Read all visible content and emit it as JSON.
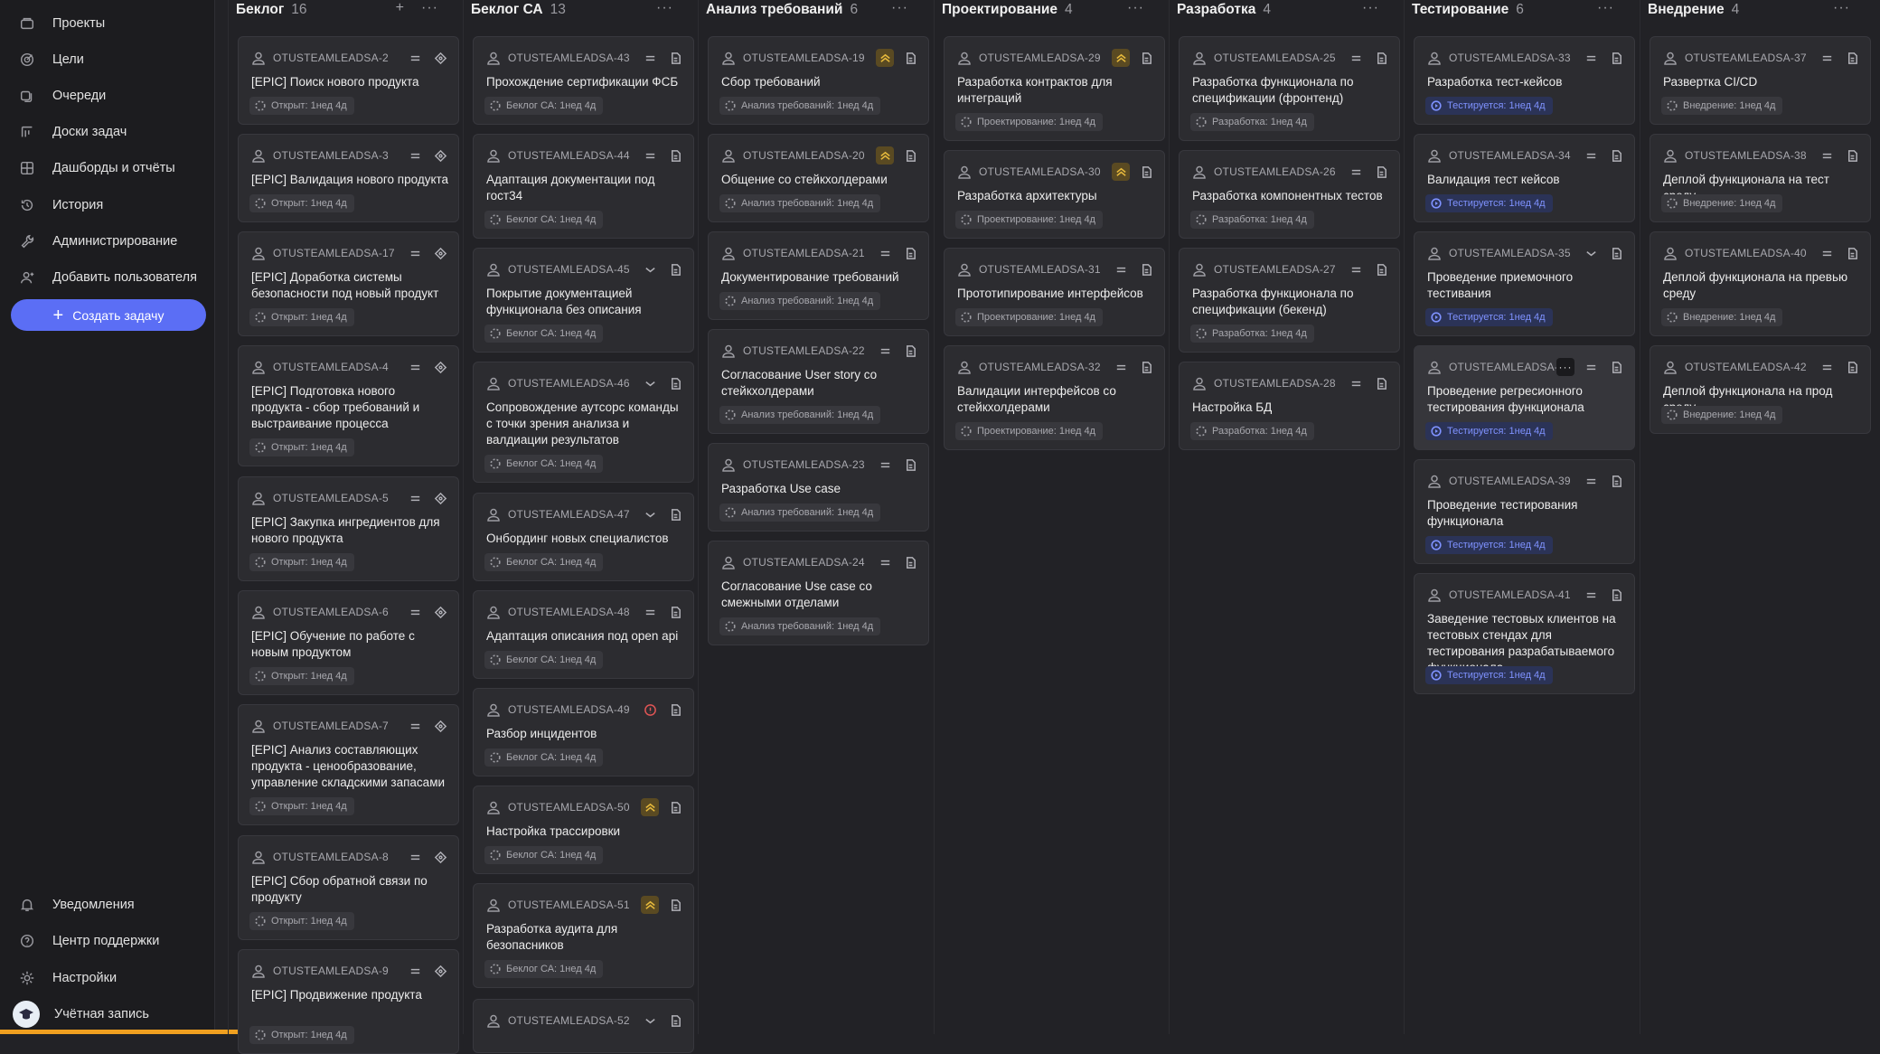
{
  "sidebar": {
    "items": [
      {
        "label": "Проекты",
        "icon": "projects-icon"
      },
      {
        "label": "Цели",
        "icon": "goals-icon"
      },
      {
        "label": "Очереди",
        "icon": "queues-icon"
      },
      {
        "label": "Доски задач",
        "icon": "boards-icon"
      },
      {
        "label": "Дашборды и отчёты",
        "icon": "dashboards-icon"
      },
      {
        "label": "История",
        "icon": "history-icon"
      },
      {
        "label": "Администрирование",
        "icon": "admin-icon"
      },
      {
        "label": "Добавить пользователя",
        "icon": "add-user-icon"
      }
    ],
    "create_label": "Создать задачу",
    "bottom": [
      {
        "label": "Уведомления",
        "icon": "bell-icon"
      },
      {
        "label": "Центр поддержки",
        "icon": "help-icon"
      },
      {
        "label": "Настройки",
        "icon": "gear-icon"
      },
      {
        "label": "Учётная запись",
        "icon": "avatar"
      }
    ]
  },
  "columns": [
    {
      "title": "Беклог",
      "count": "16",
      "add_label": "+",
      "more_label": "···",
      "cards": [
        {
          "key": "OTUSTEAMLEADSA-2",
          "title": "[EPIC] Поиск нового продукта",
          "status": "Открыт: 1нед 4д",
          "type": "epic",
          "prio": "none"
        },
        {
          "key": "OTUSTEAMLEADSA-3",
          "title": "[EPIC] Валидация нового продукта",
          "status": "Открыт: 1нед 4д",
          "type": "epic",
          "prio": "none"
        },
        {
          "key": "OTUSTEAMLEADSA-17",
          "title": "[EPIC] Доработка системы безопасности под новый продукт",
          "status": "Открыт: 1нед 4д",
          "type": "epic",
          "prio": "none"
        },
        {
          "key": "OTUSTEAMLEADSA-4",
          "title": "[EPIC] Подготовка нового продукта - сбор требований и выстраивание процесса",
          "status": "Открыт: 1нед 4д",
          "type": "epic",
          "prio": "none"
        },
        {
          "key": "OTUSTEAMLEADSA-5",
          "title": "[EPIC] Закупка ингредиентов для нового продукта",
          "status": "Открыт: 1нед 4д",
          "type": "epic",
          "prio": "none"
        },
        {
          "key": "OTUSTEAMLEADSA-6",
          "title": "[EPIC] Обучение по работе с новым продуктом",
          "status": "Открыт: 1нед 4д",
          "type": "epic",
          "prio": "none"
        },
        {
          "key": "OTUSTEAMLEADSA-7",
          "title": "[EPIC] Анализ составляющих продукта - ценообразование, управление складскими запасами",
          "status": "Открыт: 1нед 4д",
          "type": "epic",
          "prio": "none"
        },
        {
          "key": "OTUSTEAMLEADSA-8",
          "title": "[EPIC] Сбор обратной связи по продукту",
          "status": "Открыт: 1нед 4д",
          "type": "epic",
          "prio": "none"
        },
        {
          "key": "OTUSTEAMLEADSA-9",
          "title": "[EPIC] Продвижение продукта",
          "status": "Открыт: 1нед 4д",
          "type": "epic",
          "prio": "none"
        }
      ]
    },
    {
      "title": "Беклог СА",
      "count": "13",
      "more_label": "···",
      "cards": [
        {
          "key": "OTUSTEAMLEADSA-43",
          "title": "Прохождение сертификации ФСБ",
          "status": "Беклог СА: 1нед 4д",
          "type": "task",
          "prio": "normal"
        },
        {
          "key": "OTUSTEAMLEADSA-44",
          "title": "Адаптация документации под гост34",
          "status": "Беклог СА: 1нед 4д",
          "type": "task",
          "prio": "normal"
        },
        {
          "key": "OTUSTEAMLEADSA-45",
          "title": "Покрытие документацией функционала без описания",
          "status": "Беклог СА: 1нед 4д",
          "type": "task",
          "prio": "low"
        },
        {
          "key": "OTUSTEAMLEADSA-46",
          "title": "Сопровождение аутсорс команды с точки зрения анализа и валдиации результатов",
          "status": "Беклог СА: 1нед 4д",
          "type": "task",
          "prio": "low"
        },
        {
          "key": "OTUSTEAMLEADSA-47",
          "title": "Онбординг новых специалистов",
          "status": "Беклог СА: 1нед 4д",
          "type": "task",
          "prio": "low"
        },
        {
          "key": "OTUSTEAMLEADSA-48",
          "title": "Адаптация описания под open api",
          "status": "Беклог СА: 1нед 4д",
          "type": "task",
          "prio": "normal"
        },
        {
          "key": "OTUSTEAMLEADSA-49",
          "title": "Разбор инцидентов",
          "status": "Беклог СА: 1нед 4д",
          "type": "task",
          "prio": "critical"
        },
        {
          "key": "OTUSTEAMLEADSA-50",
          "title": "Настройка трассировки",
          "status": "Беклог СА: 1нед 4д",
          "type": "task",
          "prio": "high"
        },
        {
          "key": "OTUSTEAMLEADSA-51",
          "title": "Разработка аудита для безопасников",
          "status": "Беклог СА: 1нед 4д",
          "type": "task",
          "prio": "high"
        },
        {
          "key": "OTUSTEAMLEADSA-52",
          "title": "",
          "status": "",
          "type": "task",
          "prio": "low"
        }
      ]
    },
    {
      "title": "Анализ требований",
      "count": "6",
      "more_label": "···",
      "cards": [
        {
          "key": "OTUSTEAMLEADSA-19",
          "title": "Сбор требований",
          "status": "Анализ требований: 1нед 4д",
          "type": "task",
          "prio": "high"
        },
        {
          "key": "OTUSTEAMLEADSA-20",
          "title": "Общение со стейкхолдерами",
          "status": "Анализ требований: 1нед 4д",
          "type": "task",
          "prio": "high"
        },
        {
          "key": "OTUSTEAMLEADSA-21",
          "title": "Документирование требований",
          "status": "Анализ требований: 1нед 4д",
          "type": "task",
          "prio": "normal"
        },
        {
          "key": "OTUSTEAMLEADSA-22",
          "title": "Согласование User story со стейкхолдерами",
          "status": "Анализ требований: 1нед 4д",
          "type": "task",
          "prio": "normal"
        },
        {
          "key": "OTUSTEAMLEADSA-23",
          "title": "Разработка Use case",
          "status": "Анализ требований: 1нед 4д",
          "type": "task",
          "prio": "normal"
        },
        {
          "key": "OTUSTEAMLEADSA-24",
          "title": "Согласование Use case со смежными отделами",
          "status": "Анализ требований: 1нед 4д",
          "type": "task",
          "prio": "normal"
        }
      ]
    },
    {
      "title": "Проектирование",
      "count": "4",
      "more_label": "···",
      "cards": [
        {
          "key": "OTUSTEAMLEADSA-29",
          "title": "Разработка контрактов для интеграций",
          "status": "Проектирование: 1нед 4д",
          "type": "task",
          "prio": "high"
        },
        {
          "key": "OTUSTEAMLEADSA-30",
          "title": "Разработка архитектуры",
          "status": "Проектирование: 1нед 4д",
          "type": "task",
          "prio": "high"
        },
        {
          "key": "OTUSTEAMLEADSA-31",
          "title": "Прототипирование интерфейсов",
          "status": "Проектирование: 1нед 4д",
          "type": "task",
          "prio": "normal"
        },
        {
          "key": "OTUSTEAMLEADSA-32",
          "title": "Валидации интерфейсов со стейкхолдерами",
          "status": "Проектирование: 1нед 4д",
          "type": "task",
          "prio": "normal"
        }
      ]
    },
    {
      "title": "Разработка",
      "count": "4",
      "more_label": "···",
      "cards": [
        {
          "key": "OTUSTEAMLEADSA-25",
          "title": "Разработка функционала по спецификации (фронтенд)",
          "status": "Разработка: 1нед 4д",
          "type": "task",
          "prio": "normal"
        },
        {
          "key": "OTUSTEAMLEADSA-26",
          "title": "Разработка компонентных тестов",
          "status": "Разработка: 1нед 4д",
          "type": "task",
          "prio": "normal"
        },
        {
          "key": "OTUSTEAMLEADSA-27",
          "title": "Разработка функционала по спецификации (бекенд)",
          "status": "Разработка: 1нед 4д",
          "type": "task",
          "prio": "normal"
        },
        {
          "key": "OTUSTEAMLEADSA-28",
          "title": "Настройка БД",
          "status": "Разработка: 1нед 4д",
          "type": "task",
          "prio": "normal"
        }
      ]
    },
    {
      "title": "Тестирование",
      "count": "6",
      "more_label": "···",
      "cards": [
        {
          "key": "OTUSTEAMLEADSA-33",
          "title": "Разработка тест-кейсов",
          "status": "Тестируется: 1нед 4д",
          "type": "task",
          "prio": "normal"
        },
        {
          "key": "OTUSTEAMLEADSA-34",
          "title": "Валидация тест кейсов",
          "status": "Тестируется: 1нед 4д",
          "type": "task",
          "prio": "normal"
        },
        {
          "key": "OTUSTEAMLEADSA-35",
          "title": "Проведение приемочного тестивания",
          "status": "Тестируется: 1нед 4д",
          "type": "task",
          "prio": "low"
        },
        {
          "key": "OTUSTEAMLEADSA-36",
          "title": "Проведение регресионного тестирования функционала",
          "status": "Тестируется: 1нед 4д",
          "type": "task",
          "prio": "normal",
          "more": "···"
        },
        {
          "key": "OTUSTEAMLEADSA-39",
          "title": "Проведение тестирования функционала",
          "status": "Тестируется: 1нед 4д",
          "type": "task",
          "prio": "normal"
        },
        {
          "key": "OTUSTEAMLEADSA-41",
          "title": "Заведение тестовых клиентов на тестовых стендах для тестирования разрабатываемого функционала",
          "status": "Тестируется: 1нед 4д",
          "type": "task",
          "prio": "normal"
        }
      ]
    },
    {
      "title": "Внедрение",
      "count": "4",
      "more_label": "···",
      "cards": [
        {
          "key": "OTUSTEAMLEADSA-37",
          "title": "Развертка CI/CD",
          "status": "Внедрение: 1нед 4д",
          "type": "task",
          "prio": "normal"
        },
        {
          "key": "OTUSTEAMLEADSA-38",
          "title": "Деплой функционала на тест среду",
          "status": "Внедрение: 1нед 4д",
          "type": "task",
          "prio": "normal"
        },
        {
          "key": "OTUSTEAMLEADSA-40",
          "title": "Деплой функционала на превью среду",
          "status": "Внедрение: 1нед 4д",
          "type": "task",
          "prio": "normal"
        },
        {
          "key": "OTUSTEAMLEADSA-42",
          "title": "Деплой функционала на прод среду",
          "status": "Внедрение: 1нед 4д",
          "type": "task",
          "prio": "normal"
        }
      ]
    }
  ],
  "colors": {
    "accent": "#5b6ef5",
    "testing_badge": "#2b3357",
    "testing_text": "#7f92ff",
    "high_priority": "#e6b93c",
    "critical_priority": "#e05555"
  }
}
